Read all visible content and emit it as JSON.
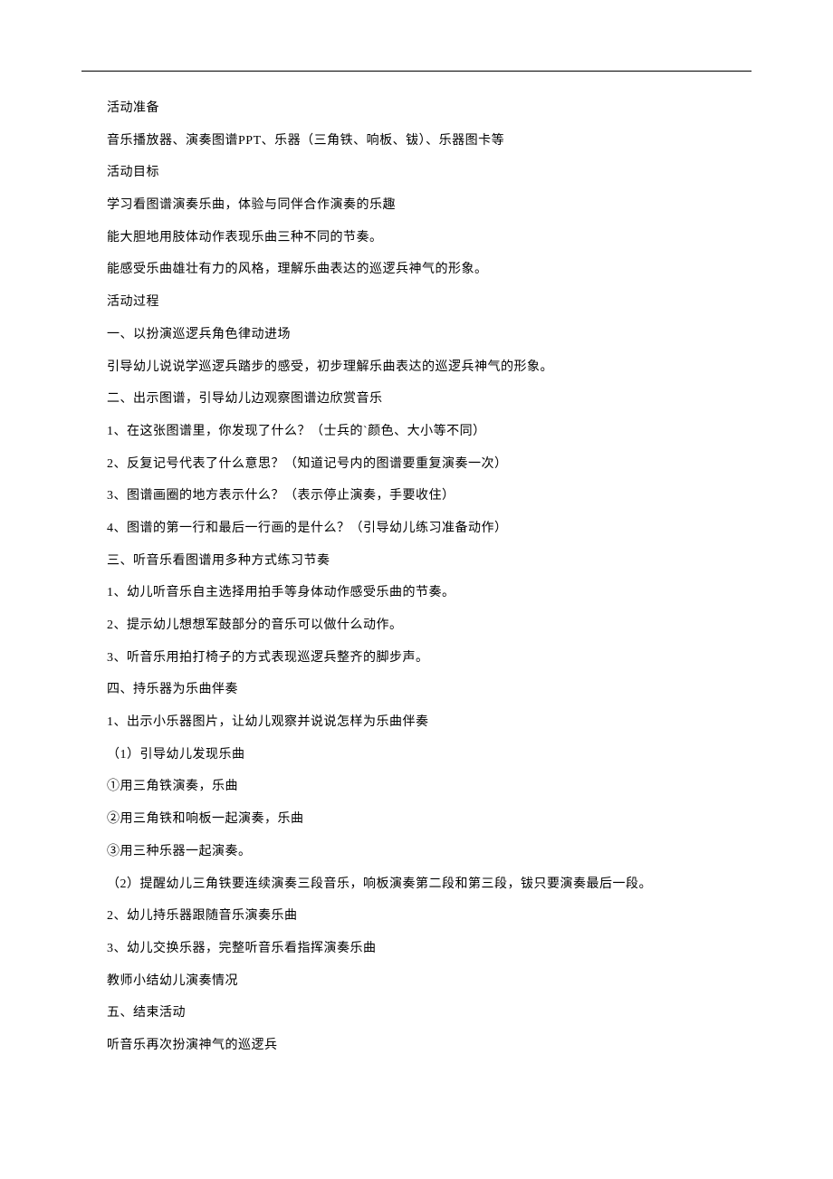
{
  "lines": [
    "活动准备",
    "音乐播放器、演奏图谱PPT、乐器（三角铁、响板、钹）、乐器图卡等",
    "活动目标",
    "学习看图谱演奏乐曲，体验与同伴合作演奏的乐趣",
    "能大胆地用肢体动作表现乐曲三种不同的节奏。",
    "能感受乐曲雄壮有力的风格，理解乐曲表达的巡逻兵神气的形象。",
    "活动过程",
    "一、以扮演巡逻兵角色律动进场",
    "引导幼儿说说学巡逻兵踏步的感受，初步理解乐曲表达的巡逻兵神气的形象。",
    "二、出示图谱，引导幼儿边观察图谱边欣赏音乐",
    "1、在这张图谱里，你发现了什么？（士兵的`颜色、大小等不同）",
    "2、反复记号代表了什么意思？（知道记号内的图谱要重复演奏一次）",
    "3、图谱画圈的地方表示什么？（表示停止演奏，手要收住）",
    "4、图谱的第一行和最后一行画的是什么？（引导幼儿练习准备动作）",
    "三、听音乐看图谱用多种方式练习节奏",
    "1、幼儿听音乐自主选择用拍手等身体动作感受乐曲的节奏。",
    "2、提示幼儿想想军鼓部分的音乐可以做什么动作。",
    "3、听音乐用拍打椅子的方式表现巡逻兵整齐的脚步声。",
    "四、持乐器为乐曲伴奏",
    "1、出示小乐器图片，让幼儿观察并说说怎样为乐曲伴奏",
    "（1）引导幼儿发现乐曲",
    "①用三角铁演奏，乐曲",
    "②用三角铁和响板一起演奏，乐曲",
    "③用三种乐器一起演奏。",
    "（2）提醒幼儿三角铁要连续演奏三段音乐，响板演奏第二段和第三段，钹只要演奏最后一段。",
    "2、幼儿持乐器跟随音乐演奏乐曲",
    "3、幼儿交换乐器，完整听音乐看指挥演奏乐曲",
    "教师小结幼儿演奏情况",
    "五、结束活动",
    "听音乐再次扮演神气的巡逻兵"
  ]
}
